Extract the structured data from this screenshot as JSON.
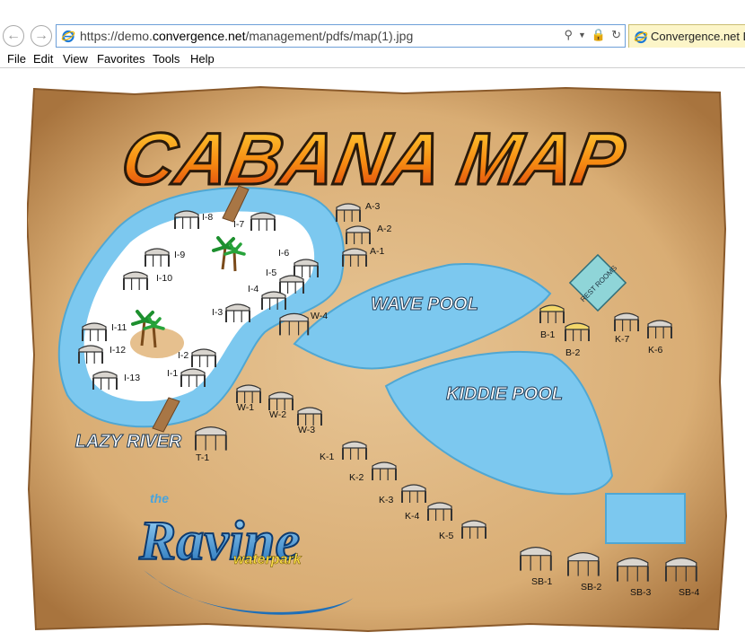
{
  "browser": {
    "url_prefix": "https://demo.",
    "url_host": "convergence.net",
    "url_path": "/management/pdfs/map(1).jpg",
    "tab_title": "Convergence.net D"
  },
  "menu": [
    "File",
    "Edit",
    "View",
    "Favorites",
    "Tools",
    "Help"
  ],
  "map": {
    "title": "CABANA MAP",
    "wave_pool": "WAVE POOL",
    "kiddie_pool": "KIDDIE POOL",
    "lazy_river": "LAZY RIVER",
    "restrooms": "REST ROOMS",
    "logo_the": "the",
    "logo_main": "Ravine",
    "logo_sub": "waterpark",
    "cabanas": [
      "I-8",
      "I-7",
      "I-9",
      "I-10",
      "I-6",
      "I-5",
      "I-4",
      "I-3",
      "I-11",
      "I-12",
      "I-13",
      "I-2",
      "I-1",
      "A-3",
      "A-2",
      "A-1",
      "W-4",
      "W-1",
      "W-2",
      "W-3",
      "T-1",
      "K-1",
      "K-2",
      "K-3",
      "K-4",
      "K-5",
      "B-1",
      "B-2",
      "K-7",
      "K-6",
      "SB-1",
      "SB-2",
      "SB-3",
      "SB-4"
    ]
  }
}
